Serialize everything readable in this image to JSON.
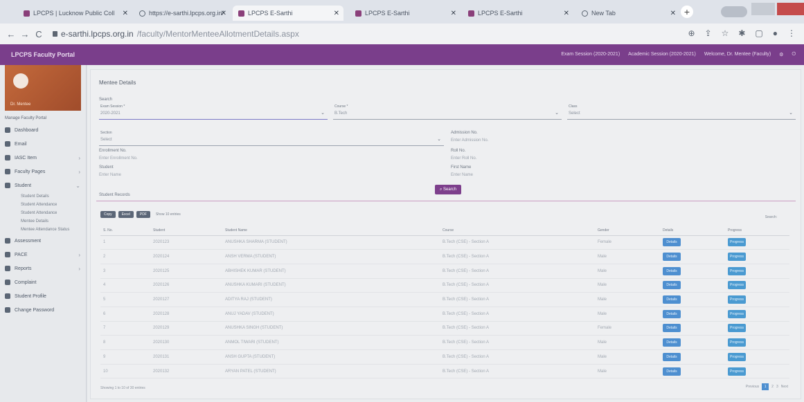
{
  "browser": {
    "tabs": [
      {
        "label": "LPCPS | Lucknow Public Coll",
        "icon": "lpcps-favicon",
        "active": false
      },
      {
        "label": "https://e-sarthi.lpcps.org.in/",
        "icon": "globe-icon",
        "active": false
      },
      {
        "label": "LPCPS E-Sarthi",
        "icon": "lpcps-favicon",
        "active": true
      },
      {
        "label": "LPCPS E-Sarthi",
        "icon": "lpcps-favicon",
        "active": false
      },
      {
        "label": "LPCPS E-Sarthi",
        "icon": "lpcps-favicon",
        "active": false
      },
      {
        "label": "New Tab",
        "icon": "globe-icon",
        "active": false
      }
    ],
    "url_host": "e-sarthi.lpcps.org.in",
    "url_path": "/faculty/MentorMenteeAllotmentDetails.aspx"
  },
  "app": {
    "title": "LPCPS Faculty Portal",
    "meta": [
      "Exam Session (2020-2021)",
      "Academic Session (2020-2021)",
      "Welcome, Dr. Mentee (Faculty)"
    ]
  },
  "sidebar": {
    "user": "Dr. Mentee",
    "section_label": "Manage Faculty Portal",
    "items": [
      {
        "label": "Dashboard",
        "chevron": false
      },
      {
        "label": "Email",
        "chevron": false
      },
      {
        "label": "IASC Item",
        "chevron": true
      },
      {
        "label": "Faculty Pages",
        "chevron": true
      },
      {
        "label": "Student",
        "chevron": true
      }
    ],
    "subitems": [
      "Student Details",
      "Student Attendance",
      "Student Attendance",
      "Mentee Details",
      "Mentee Attendance Status"
    ],
    "items_after": [
      {
        "label": "Assessment",
        "chevron": false
      },
      {
        "label": "PACE",
        "chevron": true
      },
      {
        "label": "Reports",
        "chevron": true
      },
      {
        "label": "Complaint",
        "chevron": false
      },
      {
        "label": "Student Profile",
        "chevron": false
      },
      {
        "label": "Change Password",
        "chevron": false
      }
    ]
  },
  "form": {
    "card_title": "Mentee Details",
    "search_section": "Search",
    "fields": {
      "exam_session": {
        "label": "Exam Session *",
        "value": "2020-2021"
      },
      "course": {
        "label": "Course *",
        "value": "B.Tech"
      },
      "class": {
        "label": "Class",
        "value": "Select"
      },
      "section": {
        "label": "Section",
        "value": "Select"
      },
      "admission_no": {
        "label": "Admission No.",
        "value": "Enter Admission No."
      },
      "enrollment_no": {
        "label": "Enrollment No.",
        "value": "Enter Enrollment No."
      },
      "roll_no": {
        "label": "Roll No.",
        "value": "Enter Roll No."
      },
      "student_name": {
        "label": "Student",
        "value": "Enter Name"
      },
      "first_name": {
        "label": "First Name",
        "value": "Enter Name"
      }
    },
    "search_button": "Search"
  },
  "table": {
    "section_title": "Student Records",
    "toolbar": [
      "Copy",
      "Excel",
      "PDF"
    ],
    "show_label": "Show 10 entries",
    "search_label": "Search:",
    "columns": [
      "S. No.",
      "Student",
      "Student Name",
      "Course",
      "Gender",
      "Details",
      "Progress"
    ],
    "rows": [
      {
        "sno": "1",
        "id": "2020123",
        "name": "ANUSHKA SHARMA (STUDENT)",
        "course": "B.Tech (CSE) - Section A",
        "gender": "Female"
      },
      {
        "sno": "2",
        "id": "2020124",
        "name": "ANSH VERMA (STUDENT)",
        "course": "B.Tech (CSE) - Section A",
        "gender": "Male"
      },
      {
        "sno": "3",
        "id": "2020125",
        "name": "ABHISHEK KUMAR (STUDENT)",
        "course": "B.Tech (CSE) - Section A",
        "gender": "Male"
      },
      {
        "sno": "4",
        "id": "2020126",
        "name": "ANUSHKA KUMARI (STUDENT)",
        "course": "B.Tech (CSE) - Section A",
        "gender": "Male"
      },
      {
        "sno": "5",
        "id": "2020127",
        "name": "ADITYA RAJ (STUDENT)",
        "course": "B.Tech (CSE) - Section A",
        "gender": "Male"
      },
      {
        "sno": "6",
        "id": "2020128",
        "name": "ANUJ YADAV (STUDENT)",
        "course": "B.Tech (CSE) - Section A",
        "gender": "Male"
      },
      {
        "sno": "7",
        "id": "2020129",
        "name": "ANUSHKA SINGH (STUDENT)",
        "course": "B.Tech (CSE) - Section A",
        "gender": "Female"
      },
      {
        "sno": "8",
        "id": "2020130",
        "name": "ANMOL TIWARI (STUDENT)",
        "course": "B.Tech (CSE) - Section A",
        "gender": "Male"
      },
      {
        "sno": "9",
        "id": "2020131",
        "name": "ANSH GUPTA (STUDENT)",
        "course": "B.Tech (CSE) - Section A",
        "gender": "Male"
      },
      {
        "sno": "10",
        "id": "2020132",
        "name": "ARYAN PATEL (STUDENT)",
        "course": "B.Tech (CSE) - Section A",
        "gender": "Male"
      }
    ],
    "details_label": "Details",
    "progress_label": "Progress",
    "footer": "Showing 1 to 10 of 30 entries",
    "pager": {
      "prev": "Previous",
      "current": "1",
      "pages": [
        "2",
        "3"
      ],
      "next": "Next"
    }
  },
  "colors": {
    "brand": "#7a3e8b",
    "action": "#4e8fd0"
  }
}
